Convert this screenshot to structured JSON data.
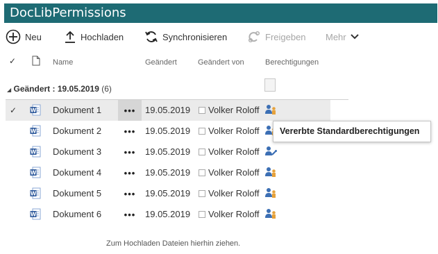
{
  "title": "DocLibPermissions",
  "toolbar": {
    "new_label": "Neu",
    "upload_label": "Hochladen",
    "sync_label": "Synchronisieren",
    "share_label": "Freigeben",
    "more_label": "Mehr"
  },
  "columns": {
    "name": "Name",
    "modified": "Geändert",
    "modified_by": "Geändert von",
    "permissions": "Berechtigungen"
  },
  "group": {
    "label": "Geändert : 19.05.2019",
    "count": "(6)"
  },
  "rows": [
    {
      "name": "Dokument 1",
      "date": "19.05.2019",
      "user": "Volker Roloff",
      "perm_icon": "inherited-permissions-icon"
    },
    {
      "name": "Dokument 2",
      "date": "19.05.2019",
      "user": "Volker Roloff",
      "perm_icon": "inherited-permissions-icon"
    },
    {
      "name": "Dokument 3",
      "date": "19.05.2019",
      "user": "Volker Roloff",
      "perm_icon": "unique-permissions-icon"
    },
    {
      "name": "Dokument 4",
      "date": "19.05.2019",
      "user": "Volker Roloff",
      "perm_icon": "inherited-permissions-icon"
    },
    {
      "name": "Dokument 5",
      "date": "19.05.2019",
      "user": "Volker Roloff",
      "perm_icon": "inherited-permissions-icon"
    },
    {
      "name": "Dokument 6",
      "date": "19.05.2019",
      "user": "Volker Roloff",
      "perm_icon": "inherited-permissions-icon"
    }
  ],
  "ellipsis": "•••",
  "tooltip": "Vererbte Standardberechtigungen",
  "drop_hint": "Zum Hochladen Dateien hierhin ziehen.",
  "colors": {
    "title_bar": "#1e6b74",
    "word_blue": "#2b579a",
    "person_blue": "#3c6fb4",
    "person_orange": "#e6a23c"
  }
}
